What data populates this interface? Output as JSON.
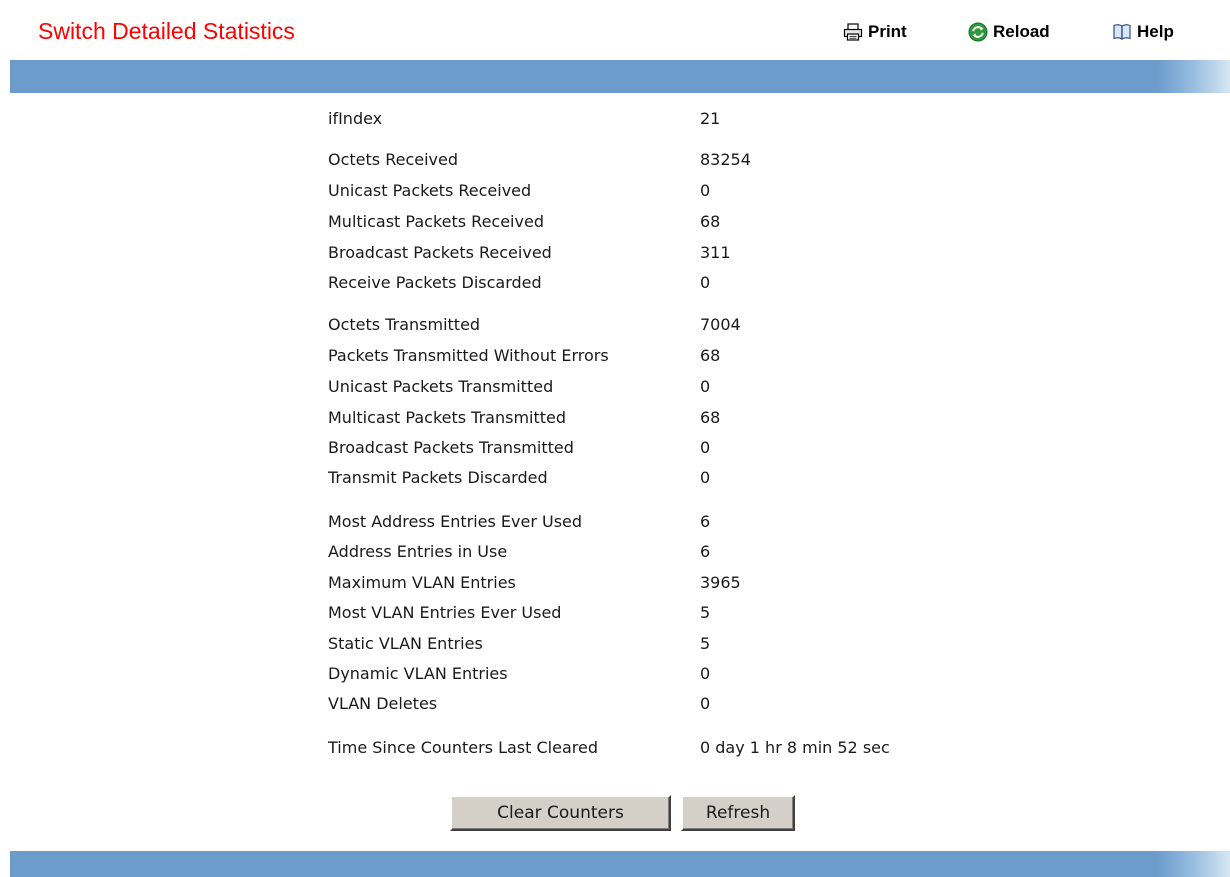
{
  "page": {
    "title": "Switch Detailed Statistics"
  },
  "toolbar": {
    "print_label": "Print",
    "reload_label": "Reload",
    "help_label": "Help"
  },
  "stats": [
    {
      "label": "ifIndex",
      "value": "21"
    },
    {
      "label": "Octets Received",
      "value": "83254"
    },
    {
      "label": "Unicast Packets Received",
      "value": "0"
    },
    {
      "label": "Multicast Packets Received",
      "value": "68"
    },
    {
      "label": "Broadcast Packets Received",
      "value": "311"
    },
    {
      "label": "Receive Packets Discarded",
      "value": "0"
    },
    {
      "label": "Octets Transmitted",
      "value": "7004"
    },
    {
      "label": "Packets Transmitted Without Errors",
      "value": "68"
    },
    {
      "label": "Unicast Packets Transmitted",
      "value": "0"
    },
    {
      "label": "Multicast Packets Transmitted",
      "value": "68"
    },
    {
      "label": "Broadcast Packets Transmitted",
      "value": "0"
    },
    {
      "label": "Transmit Packets Discarded",
      "value": "0"
    },
    {
      "label": "Most Address Entries Ever Used",
      "value": "6"
    },
    {
      "label": "Address Entries in Use",
      "value": "6"
    },
    {
      "label": "Maximum VLAN Entries",
      "value": "3965"
    },
    {
      "label": "Most VLAN Entries Ever Used",
      "value": "5"
    },
    {
      "label": "Static VLAN Entries",
      "value": "5"
    },
    {
      "label": "Dynamic VLAN Entries",
      "value": "0"
    },
    {
      "label": "VLAN Deletes",
      "value": "0"
    },
    {
      "label": "Time Since Counters Last Cleared",
      "value": "0 day 1 hr 8 min 52 sec"
    }
  ],
  "actions": {
    "clear_label": "Clear Counters",
    "refresh_label": "Refresh"
  },
  "colors": {
    "title": "#ff0000",
    "band": "#6c9bcc",
    "button_face": "#d4d0c8"
  }
}
